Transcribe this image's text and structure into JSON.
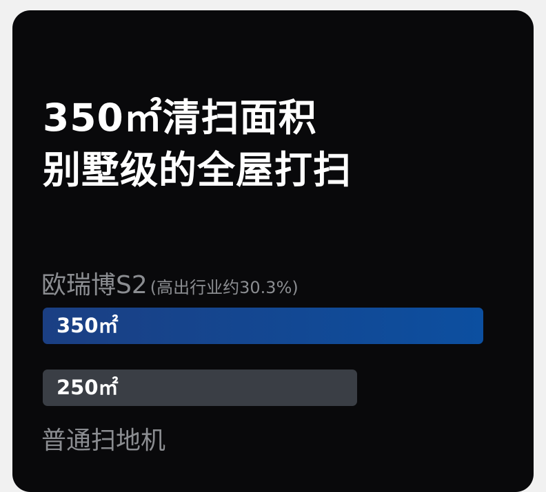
{
  "headline": {
    "line1": "350㎡清扫面积",
    "line2": "别墅级的全屋打扫"
  },
  "colors": {
    "card_background": "#09090b",
    "primary_bar_start": "#1b3f83",
    "primary_bar_end": "#0c4fa0",
    "secondary_bar": "#3a3e45",
    "label_gray": "#8b8d91"
  },
  "chart_data": {
    "type": "bar",
    "orientation": "horizontal",
    "unit": "㎡",
    "series_labels": {
      "first": "欧瑞博S2",
      "first_note": "(高出行业约30.3%)",
      "second": "普通扫地机"
    },
    "values": [
      350,
      250
    ],
    "value_labels": [
      "350㎡",
      "250㎡"
    ]
  }
}
